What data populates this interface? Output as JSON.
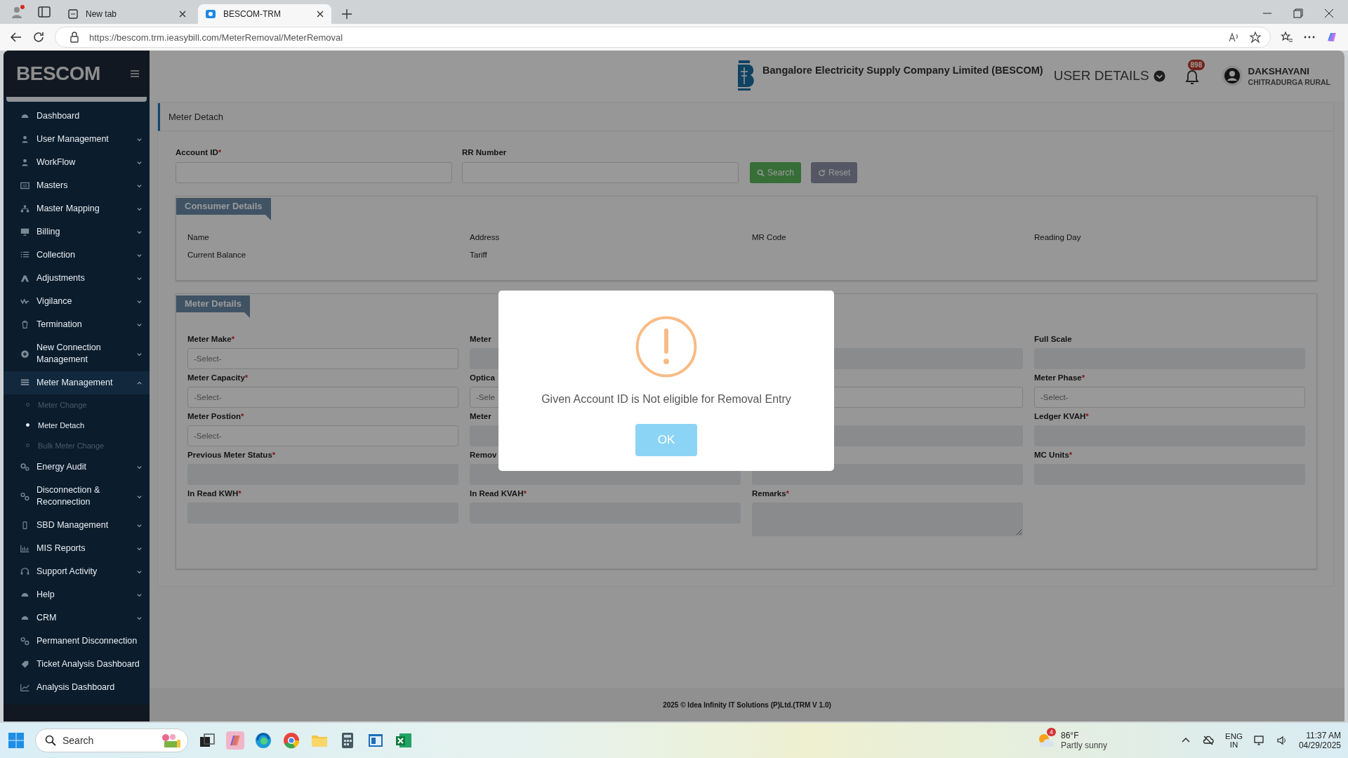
{
  "browser": {
    "tabs": [
      {
        "title": "New tab",
        "selected": false
      },
      {
        "title": "BESCOM-TRM",
        "selected": true
      }
    ],
    "url": "https://bescom.trm.ieasybill.com/MeterRemoval/MeterRemoval"
  },
  "sidebar": {
    "brand": "BESCOM",
    "items": [
      {
        "label": "Dashboard",
        "kind": "link"
      },
      {
        "label": "User Management",
        "kind": "group",
        "expanded": false
      },
      {
        "label": "WorkFlow",
        "kind": "group",
        "expanded": false
      },
      {
        "label": "Masters",
        "kind": "group",
        "expanded": false
      },
      {
        "label": "Master Mapping",
        "kind": "group",
        "expanded": false
      },
      {
        "label": "Billing",
        "kind": "group",
        "expanded": false
      },
      {
        "label": "Collection",
        "kind": "group",
        "expanded": false
      },
      {
        "label": "Adjustments",
        "kind": "group",
        "expanded": false
      },
      {
        "label": "Vigilance",
        "kind": "group",
        "expanded": false
      },
      {
        "label": "Termination",
        "kind": "group",
        "expanded": false
      },
      {
        "label": "New Connection Management",
        "kind": "group",
        "expanded": false
      },
      {
        "label": "Meter Management",
        "kind": "group",
        "expanded": true,
        "children": [
          {
            "label": "Meter Change",
            "selected": false
          },
          {
            "label": "Meter Detach",
            "selected": true
          },
          {
            "label": "Bulk Meter Change",
            "selected": false
          }
        ]
      },
      {
        "label": "Energy Audit",
        "kind": "group",
        "expanded": false
      },
      {
        "label": "Disconnection & Reconnection",
        "kind": "group",
        "expanded": false
      },
      {
        "label": "SBD Management",
        "kind": "group",
        "expanded": false
      },
      {
        "label": "MIS Reports",
        "kind": "group",
        "expanded": false
      },
      {
        "label": "Support Activity",
        "kind": "group",
        "expanded": false
      },
      {
        "label": "Help",
        "kind": "group",
        "expanded": false
      },
      {
        "label": "CRM",
        "kind": "group",
        "expanded": false
      },
      {
        "label": "Permanent Disconnection",
        "kind": "link"
      },
      {
        "label": "Ticket Analysis Dashboard",
        "kind": "link"
      },
      {
        "label": "Analysis Dashboard",
        "kind": "link"
      }
    ]
  },
  "header": {
    "company": "Bangalore Electricity Supply Company Limited (BESCOM)",
    "user_menu": "USER DETAILS",
    "notifications": "898",
    "user": {
      "name": "DAKSHAYANI",
      "location": "CHITRADURGA RURAL"
    }
  },
  "page": {
    "title": "Meter Detach",
    "search_form": {
      "fields": [
        {
          "label": "Account ID",
          "required_mark": "*"
        },
        {
          "label": "RR Number"
        }
      ],
      "buttons": [
        {
          "label": "Search",
          "kind": "search"
        },
        {
          "label": "Reset",
          "kind": "reset"
        }
      ]
    },
    "consumer_details": {
      "title": "Consumer Details",
      "fields": [
        "Name",
        "Address",
        "MR Code",
        "Reading Day",
        "Current Balance",
        "Tariff"
      ]
    },
    "meter_details": {
      "title": "Meter Details",
      "fields": [
        {
          "label": "Meter Make",
          "required_mark": "*",
          "kind": "select",
          "placeholder": "-Select-"
        },
        {
          "label": "Meter",
          "kind": "input"
        },
        {
          "kind": "input"
        },
        {
          "label": "Full Scale",
          "kind": "input"
        },
        {
          "label": "Meter Capacity",
          "required_mark": "*",
          "kind": "select",
          "placeholder": "-Select-"
        },
        {
          "label": "Optica",
          "kind": "select",
          "placeholder": "-Sele"
        },
        {
          "kind": "select"
        },
        {
          "label": "Meter Phase",
          "required_mark": "*",
          "kind": "select",
          "placeholder": "-Select-"
        },
        {
          "label": "Meter Postion",
          "required_mark": "*",
          "kind": "select",
          "placeholder": "-Select-"
        },
        {
          "label": "Meter",
          "kind": "input"
        },
        {
          "kind": "input"
        },
        {
          "label": "Ledger KVAH",
          "required_mark": "*",
          "kind": "input"
        },
        {
          "label": "Previous Meter Status",
          "required_mark": "*",
          "kind": "input"
        },
        {
          "label": "Remov",
          "kind": "input"
        },
        {
          "kind": "input"
        },
        {
          "label": "MC Units",
          "required_mark": "*",
          "kind": "input"
        },
        {
          "label": "In Read KWH",
          "required_mark": "*",
          "kind": "input"
        },
        {
          "label": "In Read KVAH",
          "required_mark": "*",
          "kind": "input"
        },
        {
          "label": "Remarks",
          "required_mark": "*",
          "kind": "textarea"
        }
      ]
    }
  },
  "footer": "2025 © Idea Infinity IT Solutions (P)Ltd.(TRM V 1.0)",
  "dialog": {
    "message": "Given Account ID is Not eligible for Removal Entry",
    "button": "OK"
  },
  "taskbar": {
    "search_placeholder": "Search",
    "weather": {
      "badge": "4",
      "temperature": "86°F",
      "condition": "Partly sunny"
    },
    "language": "ENG",
    "region": "IN",
    "time": "11:37 AM",
    "date": "04/29/2025"
  }
}
